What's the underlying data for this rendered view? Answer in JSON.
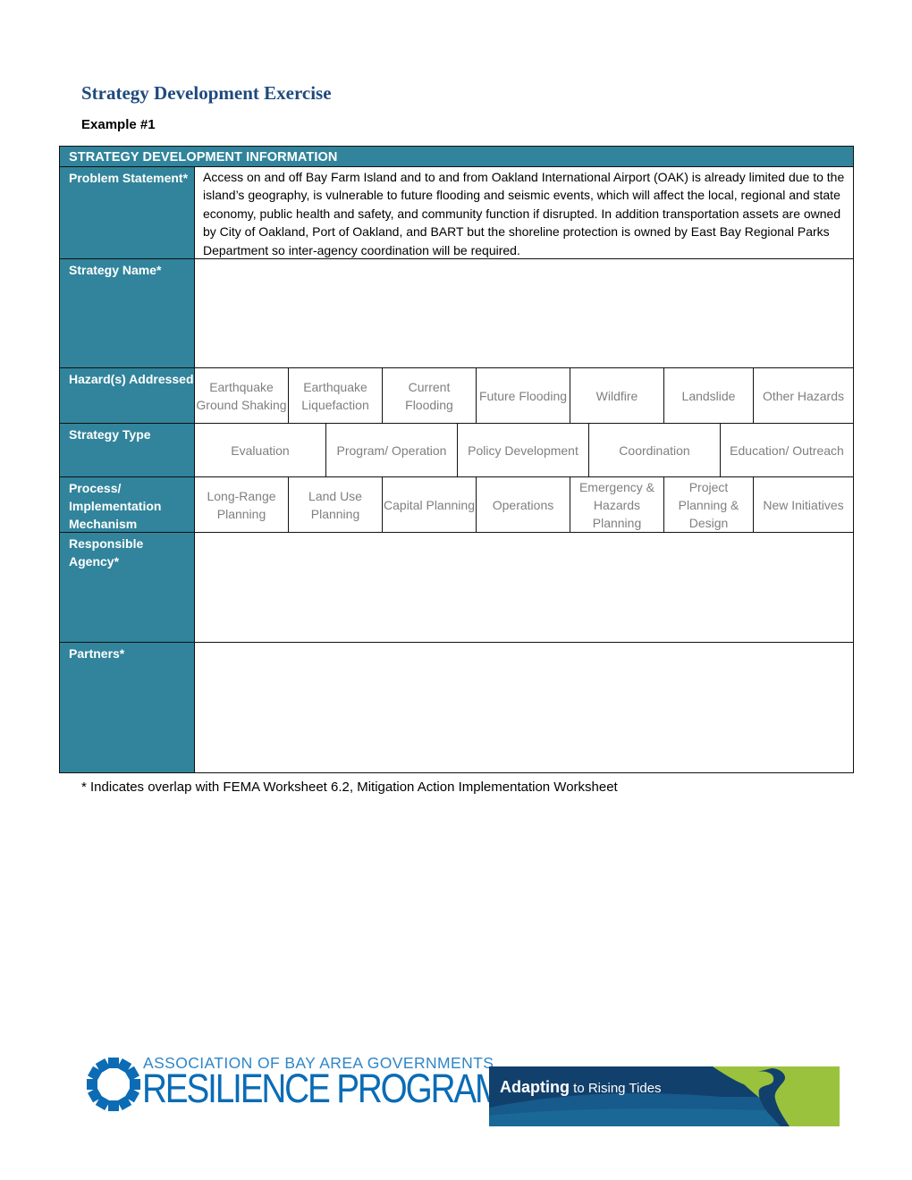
{
  "document": {
    "title": "Strategy Development Exercise",
    "subtitle": "Example #1"
  },
  "form": {
    "header": "STRATEGY DEVELOPMENT INFORMATION",
    "problem_statement": {
      "label": "Problem Statement*",
      "value": "Access on and off Bay Farm Island and to and from Oakland International Airport (OAK) is already limited due to the island’s geography, is vulnerable to future flooding and seismic events, which will affect the local, regional and state economy, public health and safety, and community function if disrupted.  In addition transportation assets are owned by City of Oakland, Port of Oakland, and BART but the shoreline protection is owned by East Bay Regional Parks Department so inter-agency coordination will be required."
    },
    "strategy_name": {
      "label": "Strategy Name*",
      "value": ""
    },
    "hazards": {
      "label": "Hazard(s) Addressed",
      "options": [
        "Earthquake Ground Shaking",
        "Earthquake Liquefaction",
        "Current Flooding",
        "Future Flooding",
        "Wildfire",
        "Landslide",
        "Other Hazards"
      ]
    },
    "strategy_type": {
      "label": "Strategy Type",
      "options": [
        "Evaluation",
        "Program/ Operation",
        "Policy Development",
        "Coordination",
        "Education/ Outreach"
      ]
    },
    "process": {
      "label": "Process/ Implementation Mechanism",
      "options": [
        "Long-Range Planning",
        "Land Use Planning",
        "Capital Planning",
        "Operations",
        "Emergency & Hazards Planning",
        "Project Planning & Design",
        "New Initiatives"
      ]
    },
    "responsible_agency": {
      "label": "Responsible Agency*",
      "value": ""
    },
    "partners": {
      "label": "Partners*",
      "value": ""
    }
  },
  "footnote": "* Indicates overlap with FEMA Worksheet 6.2, Mitigation Action Implementation Worksheet",
  "logos": {
    "abag": {
      "line1": "ASSOCIATION OF BAY AREA GOVERNMENTS",
      "line2": "RESILIENCE PROGRAM"
    },
    "art": {
      "bold": "Adapting",
      "light": " to Rising Tides"
    }
  },
  "colors": {
    "label_bg": "#31849b",
    "title": "#1f497d",
    "option_text": "#7f7f7f",
    "abag_blue": "#0b6cb5",
    "art_navy": "#12406c",
    "art_green": "#9bc23c"
  }
}
